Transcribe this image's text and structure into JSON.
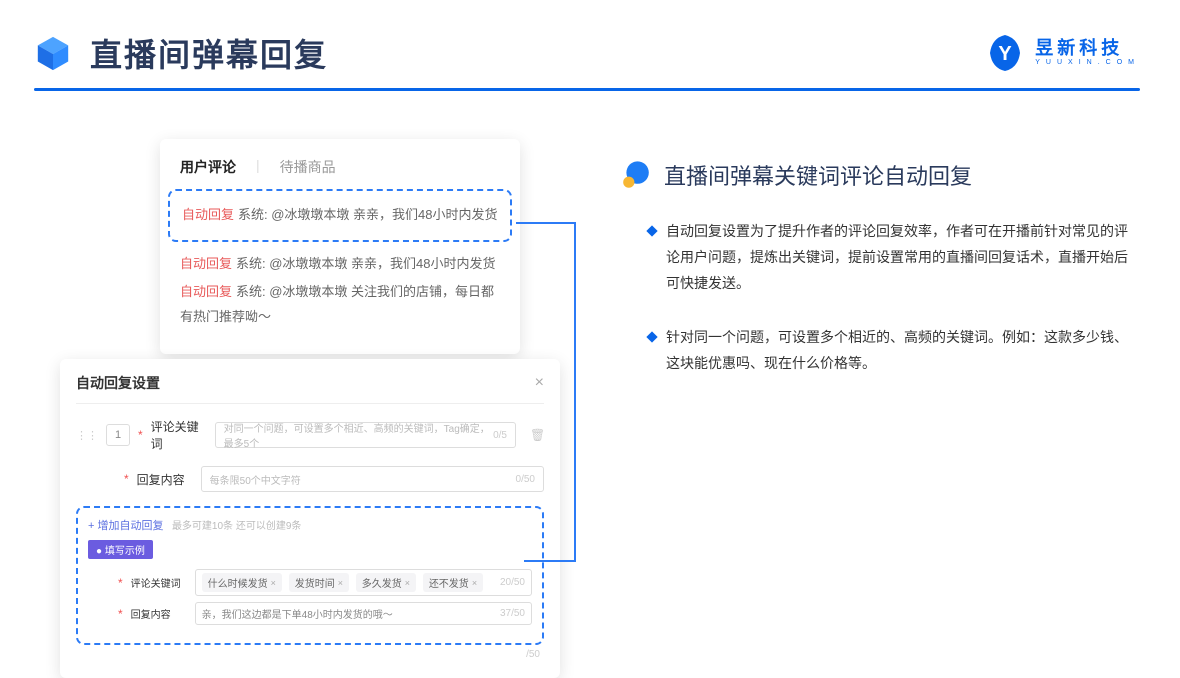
{
  "header": {
    "title": "直播间弹幕回复",
    "brand_cn": "昱新科技",
    "brand_en": "YUUXIN.COM"
  },
  "card1": {
    "tab_active": "用户评论",
    "tab_inactive": "待播商品",
    "highlighted": {
      "tag": "自动回复",
      "text": "系统: @冰墩墩本墩 亲亲，我们48小时内发货"
    },
    "c2": {
      "tag": "自动回复",
      "text": "系统: @冰墩墩本墩 亲亲，我们48小时内发货"
    },
    "c3": {
      "tag": "自动回复",
      "text": "系统: @冰墩墩本墩 关注我们的店铺，每日都有热门推荐呦～"
    }
  },
  "card2": {
    "title": "自动回复设置",
    "row_num": "1",
    "label1": "评论关键词",
    "placeholder1": "对同一个问题，可设置多个相近、高频的关键词，Tag确定，最多5个",
    "counter1": "0/5",
    "label2": "回复内容",
    "placeholder2": "每条限50个中文字符",
    "counter2": "0/50",
    "add_text": "+ 增加自动回复",
    "add_hint": "最多可建10条 还可以创建9条",
    "example_tag": "● 填写示例",
    "ex_label1": "评论关键词",
    "chips": [
      "什么时候发货",
      "发货时间",
      "多久发货",
      "还不发货"
    ],
    "ex_counter1": "20/50",
    "ex_label2": "回复内容",
    "ex_value": "亲，我们这边都是下单48小时内发货的哦～",
    "ex_counter2": "37/50",
    "outer_counter": "/50"
  },
  "right": {
    "section_title": "直播间弹幕关键词评论自动回复",
    "bullet1": "自动回复设置为了提升作者的评论回复效率，作者可在开播前针对常见的评论用户问题，提炼出关键词，提前设置常用的直播间回复话术，直播开始后可快捷发送。",
    "bullet2": "针对同一个问题，可设置多个相近的、高频的关键词。例如：这款多少钱、这块能优惠吗、现在什么价格等。"
  }
}
